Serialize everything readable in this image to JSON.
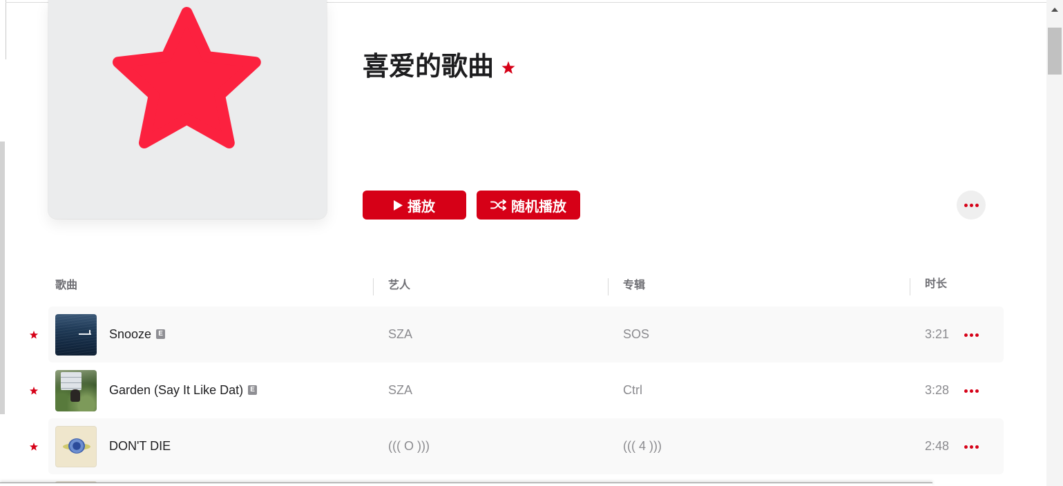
{
  "playlist": {
    "title": "喜爱的歌曲"
  },
  "actions": {
    "play_label": "播放",
    "shuffle_label": "随机播放"
  },
  "table": {
    "columns": {
      "song": "歌曲",
      "artist": "艺人",
      "album": "专辑",
      "duration": "时长"
    },
    "rows": [
      {
        "title": "Snooze",
        "explicit": true,
        "explicit_badge": "E",
        "artist": "SZA",
        "album": "SOS",
        "duration": "3:21",
        "favorite": true
      },
      {
        "title": "Garden (Say It Like Dat)",
        "explicit": true,
        "explicit_badge": "E",
        "artist": "SZA",
        "album": "Ctrl",
        "duration": "3:28",
        "favorite": true
      },
      {
        "title": "DON'T DIE",
        "explicit": false,
        "artist": "((( O )))",
        "album": "((( 4 )))",
        "duration": "2:48",
        "favorite": true
      }
    ]
  },
  "icons": {
    "artwork": "star-icon",
    "title_badge": "star-icon",
    "play": "play-icon",
    "shuffle": "shuffle-icon",
    "more": "more-icon",
    "row_favorite": "star-icon",
    "row_more": "more-icon",
    "scroll_up": "chevron-up-icon"
  },
  "colors": {
    "accent": "#d60017",
    "star": "#fc213f",
    "artwork_bg": "#ebeced",
    "row_alt_bg": "#f9f9f9"
  }
}
